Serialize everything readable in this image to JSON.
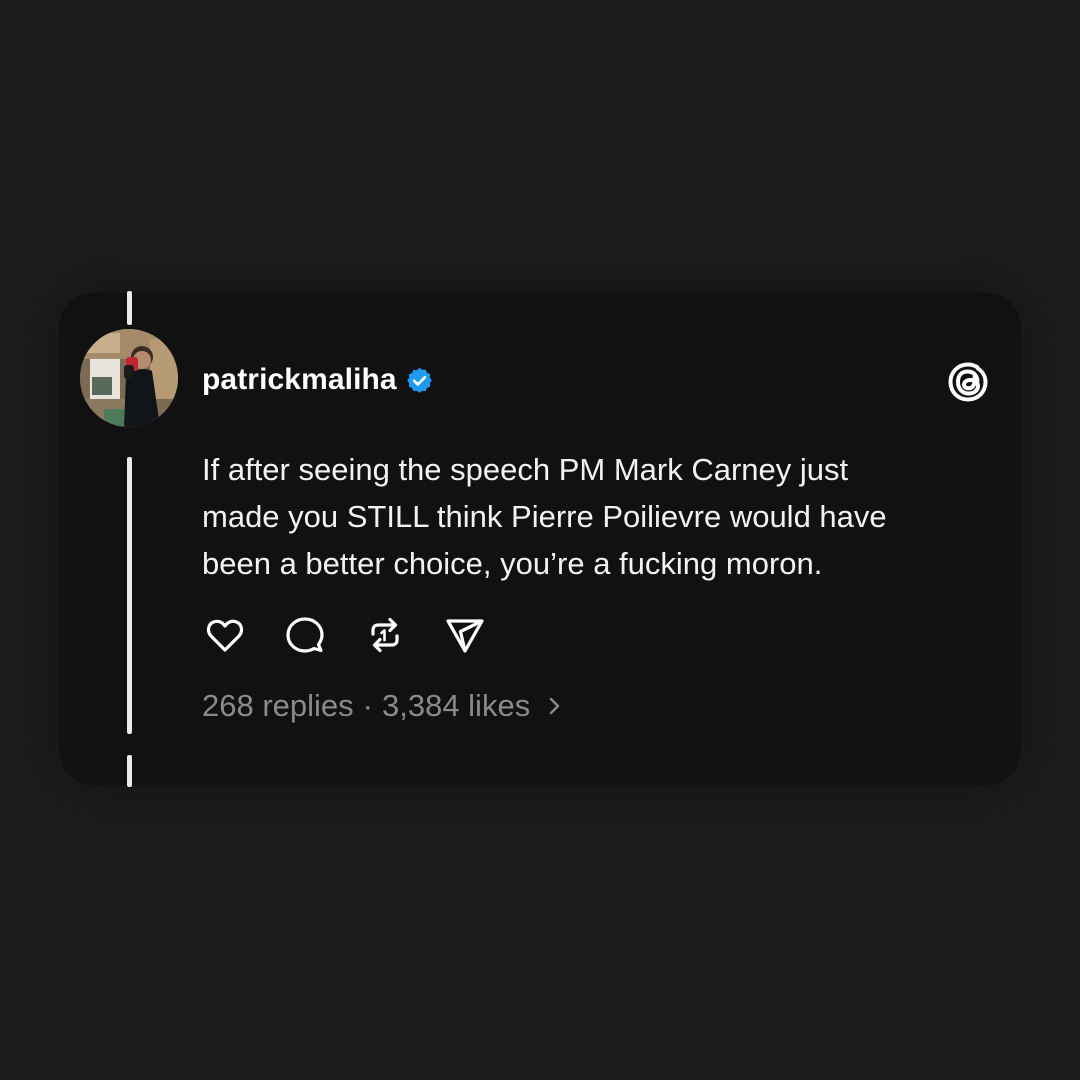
{
  "post": {
    "username": "patrickmaliha",
    "verified": true,
    "text": "If after seeing the speech PM Mark Carney just\nmade you STILL think Pierre Poilievre would have\nbeen a better choice, you’re a fucking moron.",
    "replies": "268 replies",
    "separator": "·",
    "likes": "3,384 likes"
  },
  "icons": {
    "brand": "threads-logo-icon",
    "verified": "verified-badge-icon",
    "actions": [
      "heart-icon",
      "comment-icon",
      "repost-icon",
      "share-icon"
    ],
    "stats_chevron": "chevron-right-icon"
  },
  "colors": {
    "background": "#1c1c1c",
    "card": "#111111",
    "text": "#f2f2f2",
    "muted": "#8a8a8a",
    "verified": "#1d9bf0"
  }
}
